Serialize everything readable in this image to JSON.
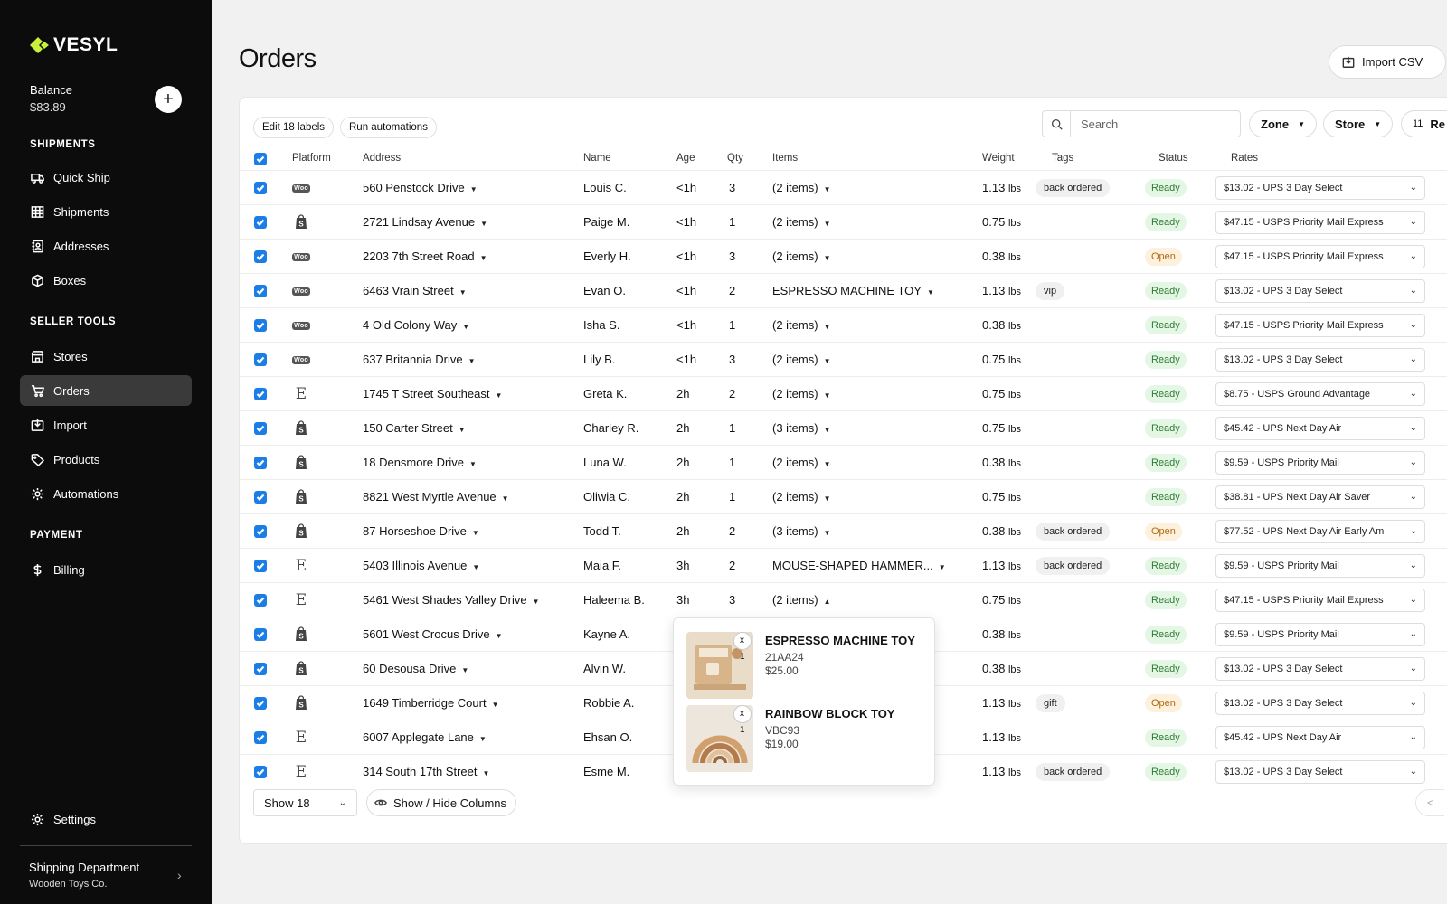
{
  "brand": {
    "name": "VESYL"
  },
  "balance": {
    "label": "Balance",
    "value": "$83.89",
    "add_label": "+"
  },
  "nav": {
    "sections": [
      {
        "title": "SHIPMENTS",
        "items": [
          {
            "label": "Quick Ship",
            "icon": "truck-icon"
          },
          {
            "label": "Shipments",
            "icon": "grid-icon"
          },
          {
            "label": "Addresses",
            "icon": "address-book-icon"
          },
          {
            "label": "Boxes",
            "icon": "box-icon"
          }
        ]
      },
      {
        "title": "SELLER TOOLS",
        "items": [
          {
            "label": "Stores",
            "icon": "store-icon"
          },
          {
            "label": "Orders",
            "icon": "cart-icon",
            "active": true
          },
          {
            "label": "Import",
            "icon": "import-icon"
          },
          {
            "label": "Products",
            "icon": "tag-icon"
          },
          {
            "label": "Automations",
            "icon": "gear-icon"
          }
        ]
      },
      {
        "title": "PAYMENT",
        "items": [
          {
            "label": "Billing",
            "icon": "dollar-icon"
          }
        ]
      }
    ],
    "settings_label": "Settings"
  },
  "account": {
    "department": "Shipping Department",
    "company": "Wooden Toys Co."
  },
  "page": {
    "title": "Orders",
    "import_label": "Import CSV"
  },
  "toolbar": {
    "edit_labels": "Edit 18 labels",
    "run_automations": "Run automations",
    "search_placeholder": "Search",
    "zone_label": "Zone",
    "store_label": "Store",
    "extra_count": "11",
    "extra_label": "Re"
  },
  "columns": [
    "Platform",
    "Address",
    "Name",
    "Age",
    "Qty",
    "Items",
    "Weight",
    "Tags",
    "Status",
    "Rates"
  ],
  "orders": [
    {
      "platform": "woo",
      "address": "560 Penstock Drive",
      "name": "Louis C.",
      "age": "<1h",
      "qty": "3",
      "items": "(2 items)",
      "weight": "1.13",
      "unit": "lbs",
      "tag": "back ordered",
      "status": "Ready",
      "rate": "$13.02 - UPS 3 Day Select"
    },
    {
      "platform": "shopify",
      "address": "2721 Lindsay Avenue",
      "name": "Paige M.",
      "age": "<1h",
      "qty": "1",
      "items": "(2 items)",
      "weight": "0.75",
      "unit": "lbs",
      "tag": "",
      "status": "Ready",
      "rate": "$47.15 - USPS Priority Mail Express"
    },
    {
      "platform": "woo",
      "address": "2203 7th Street Road",
      "name": "Everly H.",
      "age": "<1h",
      "qty": "3",
      "items": "(2 items)",
      "weight": "0.38",
      "unit": "lbs",
      "tag": "",
      "status": "Open",
      "rate": "$47.15 - USPS Priority Mail Express"
    },
    {
      "platform": "woo",
      "address": "6463 Vrain Street",
      "name": "Evan O.",
      "age": "<1h",
      "qty": "2",
      "items": "ESPRESSO MACHINE TOY",
      "weight": "1.13",
      "unit": "lbs",
      "tag": "vip",
      "status": "Ready",
      "rate": "$13.02 - UPS 3 Day Select"
    },
    {
      "platform": "woo",
      "address": "4 Old Colony Way",
      "name": "Isha S.",
      "age": "<1h",
      "qty": "1",
      "items": "(2 items)",
      "weight": "0.38",
      "unit": "lbs",
      "tag": "",
      "status": "Ready",
      "rate": "$47.15 - USPS Priority Mail Express"
    },
    {
      "platform": "woo",
      "address": "637 Britannia Drive",
      "name": "Lily B.",
      "age": "<1h",
      "qty": "3",
      "items": "(2 items)",
      "weight": "0.75",
      "unit": "lbs",
      "tag": "",
      "status": "Ready",
      "rate": "$13.02 - UPS 3 Day Select"
    },
    {
      "platform": "etsy",
      "address": "1745 T Street Southeast",
      "name": "Greta K.",
      "age": "2h",
      "qty": "2",
      "items": "(2 items)",
      "weight": "0.75",
      "unit": "lbs",
      "tag": "",
      "status": "Ready",
      "rate": "$8.75 - USPS Ground Advantage"
    },
    {
      "platform": "shopify",
      "address": "150 Carter Street",
      "name": "Charley R.",
      "age": "2h",
      "qty": "1",
      "items": "(3 items)",
      "weight": "0.75",
      "unit": "lbs",
      "tag": "",
      "status": "Ready",
      "rate": "$45.42 - UPS Next Day Air"
    },
    {
      "platform": "shopify",
      "address": "18 Densmore Drive",
      "name": "Luna W.",
      "age": "2h",
      "qty": "1",
      "items": "(2 items)",
      "weight": "0.38",
      "unit": "lbs",
      "tag": "",
      "status": "Ready",
      "rate": "$9.59 - USPS Priority Mail"
    },
    {
      "platform": "shopify",
      "address": "8821 West Myrtle Avenue",
      "name": "Oliwia C.",
      "age": "2h",
      "qty": "1",
      "items": "(2 items)",
      "weight": "0.75",
      "unit": "lbs",
      "tag": "",
      "status": "Ready",
      "rate": "$38.81 - UPS Next Day Air Saver"
    },
    {
      "platform": "shopify",
      "address": "87 Horseshoe Drive",
      "name": "Todd T.",
      "age": "2h",
      "qty": "2",
      "items": "(3 items)",
      "weight": "0.38",
      "unit": "lbs",
      "tag": "back ordered",
      "status": "Open",
      "rate": "$77.52 - UPS Next Day Air Early Am"
    },
    {
      "platform": "etsy",
      "address": "5403 Illinois Avenue",
      "name": "Maia F.",
      "age": "3h",
      "qty": "2",
      "items": "MOUSE-SHAPED HAMMER...",
      "weight": "1.13",
      "unit": "lbs",
      "tag": "back ordered",
      "status": "Ready",
      "rate": "$9.59 - USPS Priority Mail"
    },
    {
      "platform": "etsy",
      "address": "5461 West Shades Valley Drive",
      "name": "Haleema B.",
      "age": "3h",
      "qty": "3",
      "items": "(2 items)",
      "items_open": true,
      "weight": "0.75",
      "unit": "lbs",
      "tag": "",
      "status": "Ready",
      "rate": "$47.15 - USPS Priority Mail Express"
    },
    {
      "platform": "shopify",
      "address": "5601 West Crocus Drive",
      "name": "Kayne A.",
      "age": "",
      "qty": "",
      "items": "",
      "weight": "0.38",
      "unit": "lbs",
      "tag": "",
      "status": "Ready",
      "rate": "$9.59 - USPS Priority Mail"
    },
    {
      "platform": "shopify",
      "address": "60 Desousa Drive",
      "name": "Alvin W.",
      "age": "",
      "qty": "",
      "items": "",
      "weight": "0.38",
      "unit": "lbs",
      "tag": "",
      "status": "Ready",
      "rate": "$13.02 - UPS 3 Day Select"
    },
    {
      "platform": "shopify",
      "address": "1649 Timberridge Court",
      "name": "Robbie A.",
      "age": "",
      "qty": "",
      "items": "",
      "weight": "1.13",
      "unit": "lbs",
      "tag": "gift",
      "status": "Open",
      "rate": "$13.02 - UPS 3 Day Select"
    },
    {
      "platform": "etsy",
      "address": "6007 Applegate Lane",
      "name": "Ehsan O.",
      "age": "",
      "qty": "",
      "items": "",
      "weight": "1.13",
      "unit": "lbs",
      "tag": "",
      "status": "Ready",
      "rate": "$45.42 - UPS Next Day Air"
    },
    {
      "platform": "etsy",
      "address": "314 South 17th Street",
      "name": "Esme M.",
      "age": "",
      "qty": "",
      "items": "",
      "weight": "1.13",
      "unit": "lbs",
      "tag": "back ordered",
      "status": "Ready",
      "rate": "$13.02 - UPS 3 Day Select"
    }
  ],
  "popover": {
    "items": [
      {
        "qty": "x 1",
        "name": "ESPRESSO MACHINE TOY",
        "sku": "21AA24",
        "price": "$25.00"
      },
      {
        "qty": "x 1",
        "name": "RAINBOW BLOCK TOY",
        "sku": "VBC93",
        "price": "$19.00"
      }
    ]
  },
  "footer": {
    "show_label": "Show 18",
    "columns_label": "Show / Hide Columns",
    "prev_label": "<"
  },
  "colors": {
    "accent": "#1a7ee6",
    "brand_mark": "#c8f03c",
    "ready_bg": "#e4f6e4",
    "ready_text": "#2e7a34",
    "open_bg": "#fdf0dd",
    "open_text": "#b06a10",
    "sidebar_bg": "#0c0c0c"
  }
}
